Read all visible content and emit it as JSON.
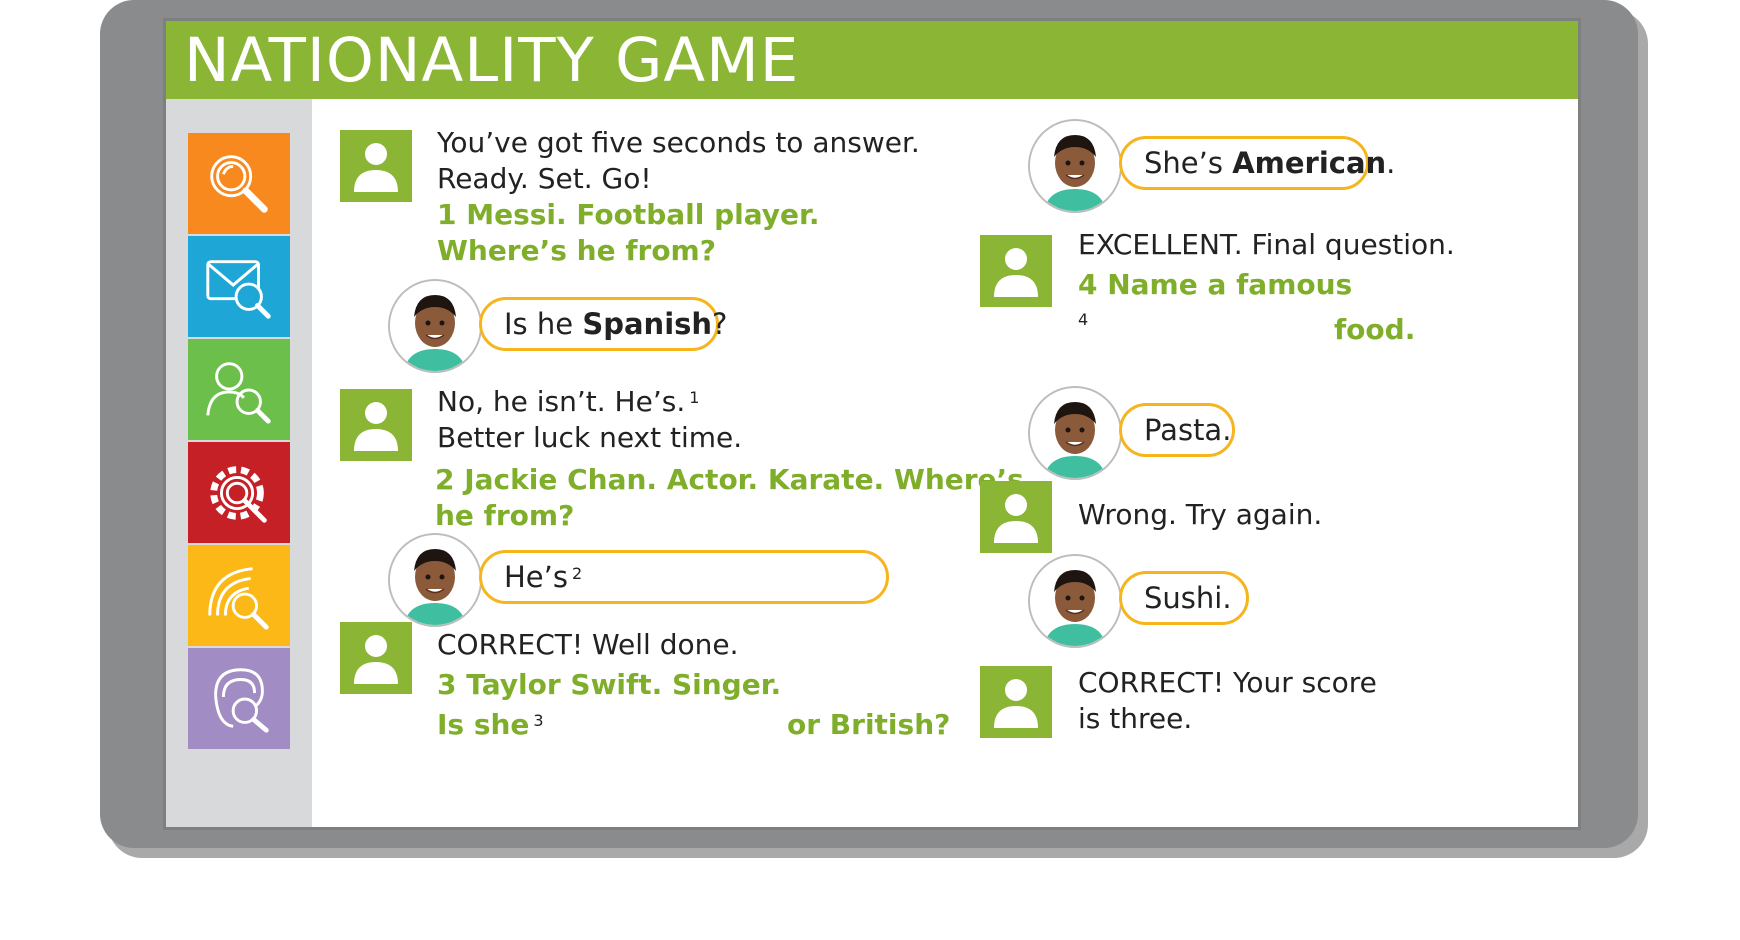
{
  "title": "NATIONALITY GAME",
  "sidebar_icons": [
    "search-icon",
    "mail-search-icon",
    "people-search-icon",
    "gear-search-icon",
    "signal-search-icon",
    "ear-search-icon"
  ],
  "colors": {
    "title_bar": "#8bb535",
    "orange": "#f7891f",
    "blue": "#1ea7d6",
    "green": "#6bbf4a",
    "red": "#c42026",
    "yellow": "#fbb816",
    "purple": "#a18cc4",
    "bubble_border": "#f6b41d",
    "question_text": "#7fae2a"
  },
  "left": {
    "t1_line1": "You’ve got five seconds to answer.",
    "t1_line2": "Ready. Set. Go!",
    "q1_line1": "1 Messi. Football player.",
    "q1_line2": "Where’s he from?",
    "b1_prefix": "Is he ",
    "b1_bold": "Spanish",
    "b1_suffix": "?",
    "t2_line1": "No, he isn’t. He’s.",
    "t2_sup": "1",
    "t2_line2": "Better luck next time.",
    "q2_line1": "2 Jackie Chan. Actor. Karate. Where’s",
    "q2_line2": "he from?",
    "b2_prefix": "He’s",
    "b2_sup": "2",
    "t3_line1": "CORRECT! Well done.",
    "q3_line1": "3 Taylor Swift. Singer.",
    "q3_line2_a": "Is she",
    "q3_sup": "3",
    "q3_or": "or ",
    "q3_bold": "British",
    "q3_end": "?"
  },
  "right": {
    "b3_prefix": "She’s ",
    "b3_bold": "American",
    "b3_suffix": ".",
    "t4_line1": "EXCELLENT. Final question.",
    "q4_line1": "4 Name a famous",
    "q4_sup": "4",
    "q4_word": "food.",
    "b4": "Pasta.",
    "t5": "Wrong. Try again.",
    "b5": "Sushi.",
    "t6_line1": "CORRECT! Your score",
    "t6_line2": "is three."
  }
}
